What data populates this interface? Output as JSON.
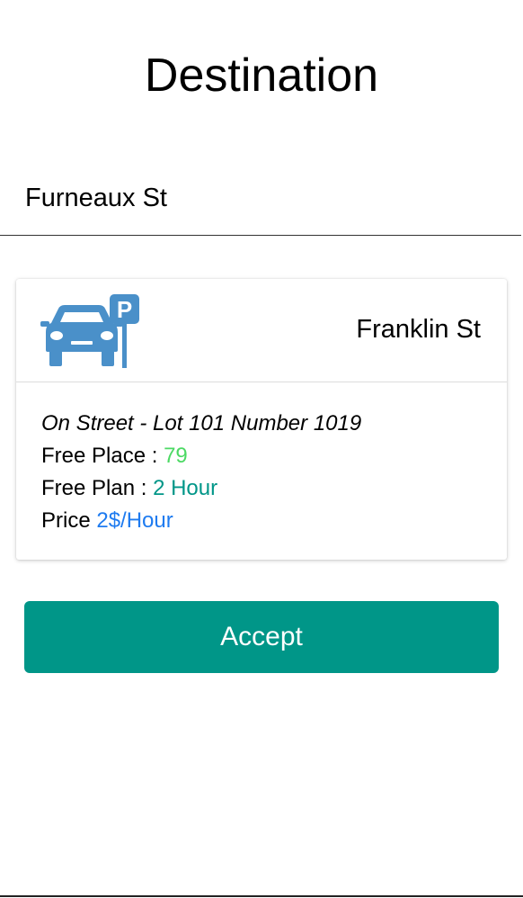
{
  "header": {
    "title": "Destination"
  },
  "destination": {
    "value": "Furneaux St"
  },
  "card": {
    "icon": "car-parking-icon",
    "icon_color": "#4a90c9",
    "street": "Franklin St",
    "lot": "On Street - Lot 101 Number 1019",
    "free_place_label": "Free Place : ",
    "free_place_value": "79",
    "free_plan_label": "Free Plan : ",
    "free_plan_value": "2 Hour",
    "price_label": "Price ",
    "price_value": "2$/Hour"
  },
  "actions": {
    "accept_label": "Accept"
  },
  "colors": {
    "accent": "#009688",
    "free_place": "#4cd964",
    "free_plan": "#009688",
    "price": "#1e7bf0"
  }
}
